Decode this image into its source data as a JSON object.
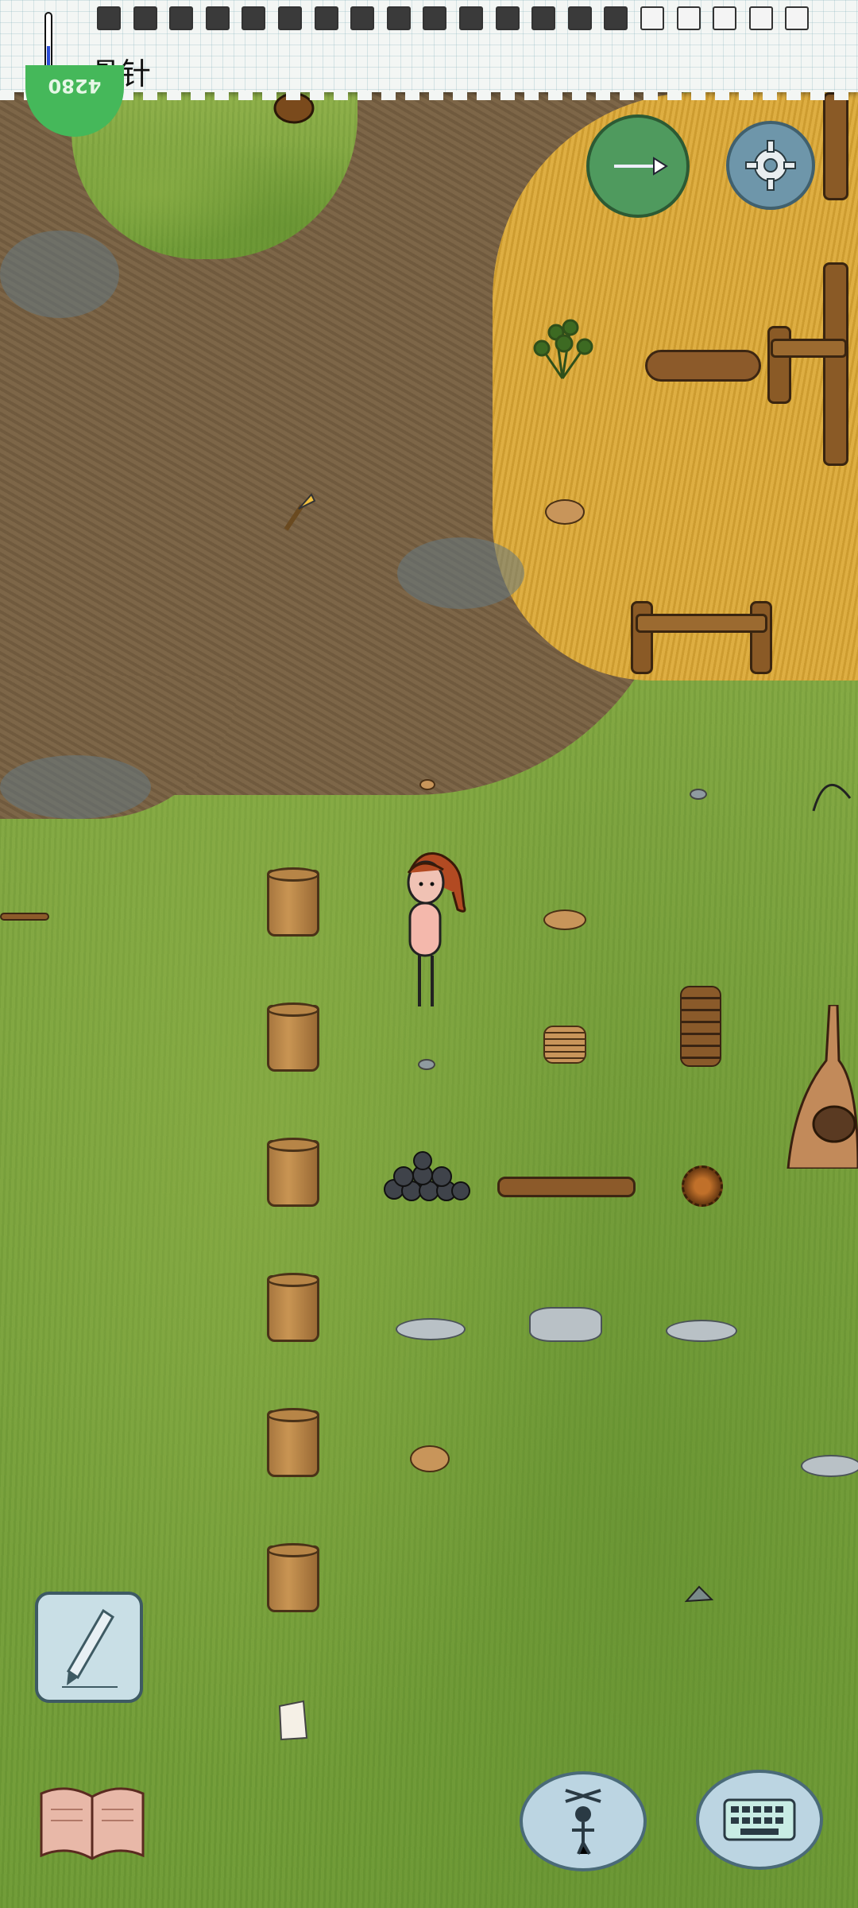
{
  "hud": {
    "held_item_label": "骨针",
    "age_display": "4280",
    "food_pips": {
      "filled": 15,
      "total": 20
    }
  },
  "icons": {
    "thermometer": "thermometer-icon",
    "compass": "compass-icon",
    "settings": "gear-icon",
    "note": "pencil-icon",
    "book": "open-book-icon",
    "emote": "puppet-icon",
    "keyboard": "keyboard-icon"
  },
  "colors": {
    "grass": "#7aa03c",
    "dirt": "#7b6445",
    "straw": "#d9a83a",
    "age_badge": "#45b85a",
    "compass": "#4f9a5e",
    "settings": "#6e96aa",
    "thermometer_bulb": "#2a4bd6"
  }
}
